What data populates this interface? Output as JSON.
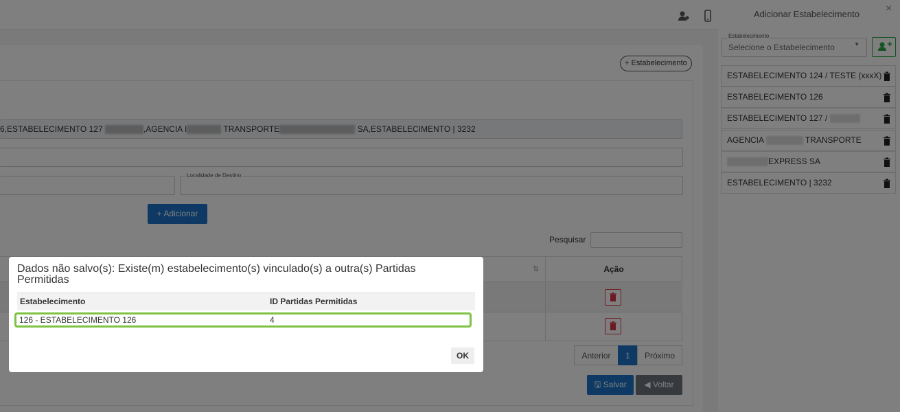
{
  "main": {
    "add_establishment_label": "+ Estabelecimento",
    "establishments_text": "6,ESTABELECIMENTO 127 ,AGENCIA TRANSPORTE SA,ESTABELECIMENTO | 3232",
    "establishments_segments": [
      "6,ESTABELECIMENTO 127 ",
      ",AGENCIA I",
      " TRANSPORTE",
      " SA,ESTABELECIMENTO | 3232"
    ],
    "destination_label": "Localidade de Destino",
    "add_button": "Adicionar",
    "search_label": "Pesquisar",
    "table_header_action": "Ação",
    "pagination": {
      "prev": "Anterior",
      "page": "1",
      "next": "Próximo"
    },
    "save_button": "Salvar",
    "back_button": "Voltar"
  },
  "panel": {
    "title": "Adicionar Estabelecimento",
    "close": "×",
    "select_label": "Estabelecimento",
    "select_placeholder": "Selecione o Estabelecimento",
    "items": [
      {
        "label": "ESTABELECIMENTO 124 / TESTE (xxxX)"
      },
      {
        "label": "ESTABELECIMENTO 126"
      },
      {
        "label": "ESTABELECIMENTO 127 /"
      },
      {
        "label_a": "AGENCIA",
        "label_b": "TRANSPORTE"
      },
      {
        "label": "EXPRESS SA"
      },
      {
        "label": "ESTABELECIMENTO | 3232"
      }
    ]
  },
  "modal": {
    "title": "Dados não salvo(s): Existe(m) estabelecimento(s) vinculado(s) a outra(s) Partidas Permitidas",
    "columns": [
      "Estabelecimento",
      "ID Partidas Permitidas"
    ],
    "rows": [
      [
        "126 - ESTABELECIMENTO 126",
        "4"
      ]
    ],
    "ok": "OK"
  },
  "colors": {
    "primary": "#1a73c8",
    "danger": "#dc3545",
    "highlight": "#7dc242",
    "success": "#28a745"
  }
}
